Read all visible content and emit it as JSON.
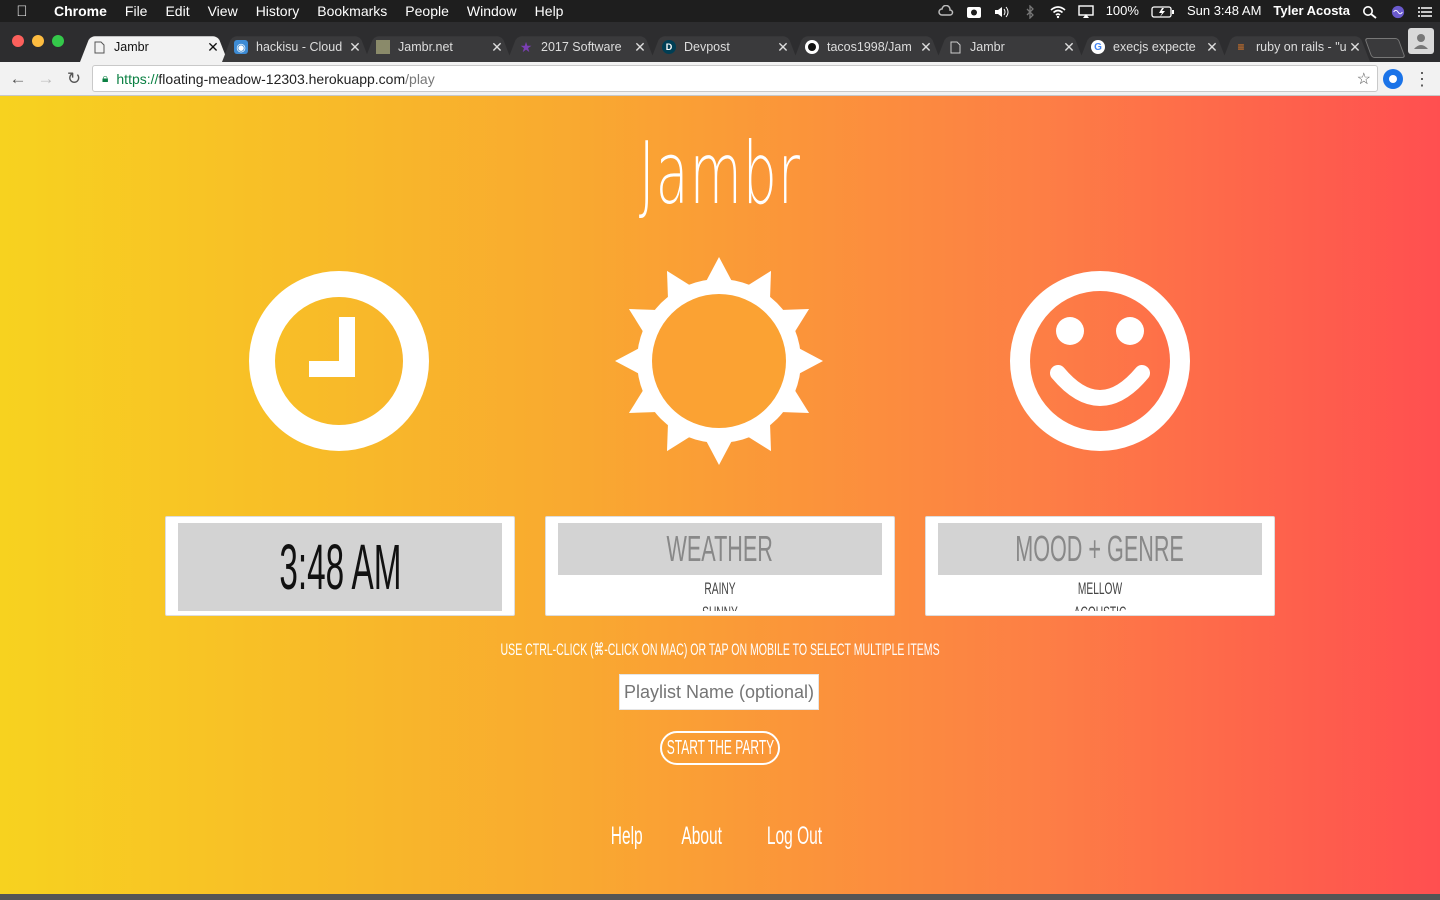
{
  "menubar": {
    "app": "Chrome",
    "items": [
      "File",
      "Edit",
      "View",
      "History",
      "Bookmarks",
      "People",
      "Window",
      "Help"
    ],
    "battery": "100%",
    "clock": "Sun 3:48 AM",
    "user": "Tyler Acosta"
  },
  "tabs": [
    {
      "label": "Jambr",
      "icon": "page-icon",
      "active": true
    },
    {
      "label": "hackisu - Cloud",
      "icon": "cloud9-icon",
      "active": false
    },
    {
      "label": "Jambr.net",
      "icon": "page-icon",
      "active": false
    },
    {
      "label": "2017 Software",
      "icon": "star-icon",
      "active": false
    },
    {
      "label": "Devpost",
      "icon": "devpost-icon",
      "active": false
    },
    {
      "label": "tacos1998/Jam",
      "icon": "github-icon",
      "active": false
    },
    {
      "label": "Jambr",
      "icon": "page-icon",
      "active": false
    },
    {
      "label": "execjs expecte",
      "icon": "google-icon",
      "active": false
    },
    {
      "label": "ruby on rails - \"u",
      "icon": "stackoverflow-icon",
      "active": false
    }
  ],
  "address": {
    "scheme": "https://",
    "host": "floating-meadow-12303.herokuapp.com",
    "path": "/play"
  },
  "page": {
    "title": "Jambr",
    "time_card": {
      "value": "3:48 AM"
    },
    "weather_card": {
      "heading": "WEATHER",
      "options": [
        "RAINY",
        "SUNNY"
      ]
    },
    "mood_card": {
      "heading": "MOOD + GENRE",
      "options": [
        "MELLOW",
        "ACOUSTIC"
      ]
    },
    "hint": "USE CTRL-CLICK (⌘-CLICK ON MAC) OR TAP ON MOBILE TO SELECT MULTIPLE ITEMS",
    "playlist_placeholder": "Playlist Name (optional)",
    "start_label": "START THE PARTY",
    "footer": {
      "help": "Help",
      "about": "About",
      "logout": "Log Out"
    }
  },
  "colors": {
    "gradient_start": "#f7d21f",
    "gradient_mid": "#f9a930",
    "gradient_end": "#ff4f50"
  }
}
